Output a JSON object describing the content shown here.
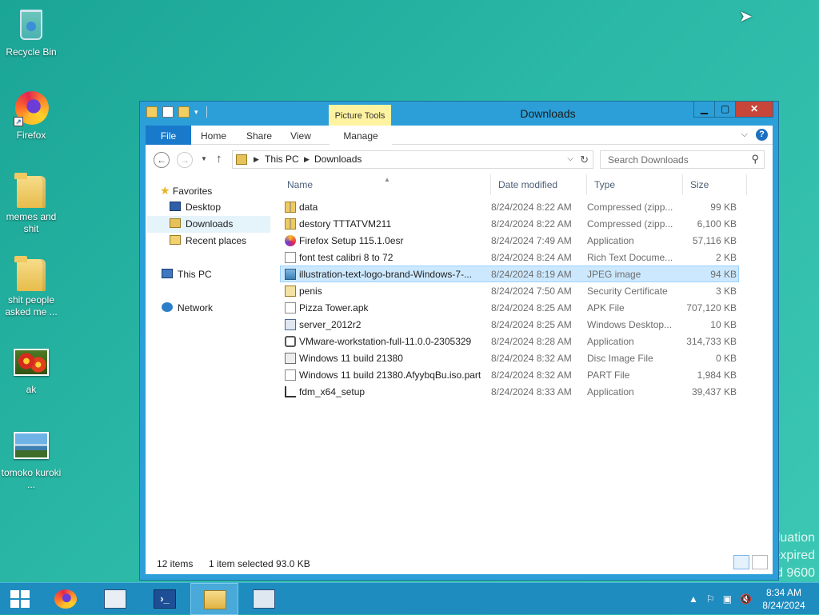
{
  "desktop": {
    "icons": [
      {
        "label": "Recycle Bin",
        "icon": "recycle-bin-icon"
      },
      {
        "label": "Firefox",
        "icon": "firefox-icon"
      },
      {
        "label": "memes and shit",
        "icon": "folder-icon"
      },
      {
        "label": "shit people asked me ...",
        "icon": "folder-icon"
      },
      {
        "label": "ak",
        "icon": "image-file-icon"
      },
      {
        "label": "tomoko kuroki ...",
        "icon": "image-file-icon"
      }
    ],
    "watermark": [
      "luation",
      "expired",
      "d 9600"
    ]
  },
  "window": {
    "title": "Downloads",
    "context_tab_group": "Picture Tools",
    "ribbon_tabs": [
      "File",
      "Home",
      "Share",
      "View",
      "Manage"
    ],
    "address": {
      "segments": [
        "This PC",
        "Downloads"
      ]
    },
    "search_placeholder": "Search Downloads",
    "nav_pane": {
      "favorites": "Favorites",
      "items": [
        "Desktop",
        "Downloads",
        "Recent places"
      ],
      "selected": "Downloads",
      "this_pc": "This PC",
      "network": "Network"
    },
    "columns": [
      "Name",
      "Date modified",
      "Type",
      "Size"
    ],
    "files": [
      {
        "name": "data",
        "date": "8/24/2024 8:22 AM",
        "type": "Compressed (zipp...",
        "size": "99 KB",
        "icon": "zip-folder-icon"
      },
      {
        "name": "destory TTTATVM211",
        "date": "8/24/2024 8:22 AM",
        "type": "Compressed (zipp...",
        "size": "6,100 KB",
        "icon": "zip-folder-icon"
      },
      {
        "name": "Firefox Setup 115.1.0esr",
        "date": "8/24/2024 7:49 AM",
        "type": "Application",
        "size": "57,116 KB",
        "icon": "firefox-setup-icon"
      },
      {
        "name": "font test calibri 8 to 72",
        "date": "8/24/2024 8:24 AM",
        "type": "Rich Text Docume...",
        "size": "2 KB",
        "icon": "document-icon"
      },
      {
        "name": "illustration-text-logo-brand-Windows-7-...",
        "date": "8/24/2024 8:19 AM",
        "type": "JPEG image",
        "size": "94 KB",
        "icon": "jpeg-icon",
        "selected": true
      },
      {
        "name": "penis",
        "date": "8/24/2024 7:50 AM",
        "type": "Security Certificate",
        "size": "3 KB",
        "icon": "certificate-icon"
      },
      {
        "name": "Pizza Tower.apk",
        "date": "8/24/2024 8:25 AM",
        "type": "APK File",
        "size": "707,120 KB",
        "icon": "document-icon"
      },
      {
        "name": "server_2012r2",
        "date": "8/24/2024 8:25 AM",
        "type": "Windows Desktop...",
        "size": "10 KB",
        "icon": "remote-desktop-icon"
      },
      {
        "name": "VMware-workstation-full-11.0.0-2305329",
        "date": "8/24/2024 8:28 AM",
        "type": "Application",
        "size": "314,733 KB",
        "icon": "vmware-icon"
      },
      {
        "name": "Windows 11 build 21380",
        "date": "8/24/2024 8:32 AM",
        "type": "Disc Image File",
        "size": "0 KB",
        "icon": "disc-image-icon"
      },
      {
        "name": "Windows 11 build 21380.AfyybqBu.iso.part",
        "date": "8/24/2024 8:32 AM",
        "type": "PART File",
        "size": "1,984 KB",
        "icon": "document-icon"
      },
      {
        "name": "fdm_x64_setup",
        "date": "8/24/2024 8:33 AM",
        "type": "Application",
        "size": "39,437 KB",
        "icon": "installer-icon"
      }
    ],
    "status": {
      "count": "12 items",
      "selection": "1 item selected  93.0 KB"
    }
  },
  "taskbar": {
    "pinned": [
      "start-button",
      "firefox",
      "server-manager",
      "powershell",
      "file-explorer",
      "control-panel"
    ],
    "active": "file-explorer",
    "clock": {
      "time": "8:34 AM",
      "date": "8/24/2024"
    }
  }
}
